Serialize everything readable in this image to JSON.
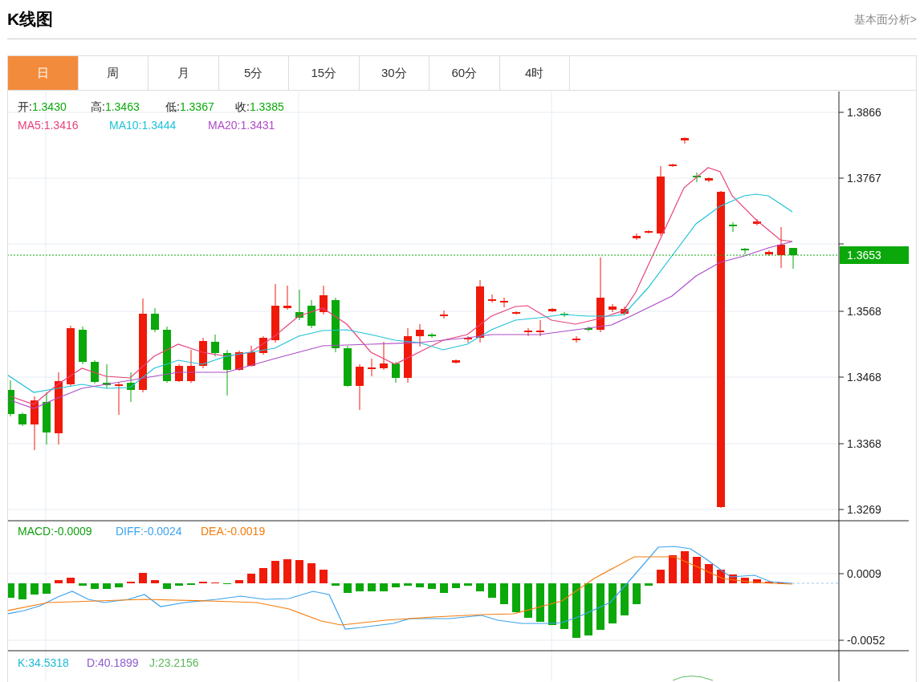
{
  "header": {
    "title": "K线图",
    "link": "基本面分析>"
  },
  "tabs": [
    {
      "label": "日",
      "selected": true
    },
    {
      "label": "周",
      "selected": false
    },
    {
      "label": "月",
      "selected": false
    },
    {
      "label": "5分",
      "selected": false
    },
    {
      "label": "15分",
      "selected": false
    },
    {
      "label": "30分",
      "selected": false
    },
    {
      "label": "60分",
      "selected": false
    },
    {
      "label": "4时",
      "selected": false
    }
  ],
  "price_legend": [
    {
      "label": "开:",
      "value": "1.3430"
    },
    {
      "label": "高:",
      "value": "1.3463"
    },
    {
      "label": "低:",
      "value": "1.3367"
    },
    {
      "label": "收:",
      "value": "1.3385"
    }
  ],
  "ma_legend": [
    {
      "label": "MA5:",
      "value": "1.3416",
      "color": "#e8417c"
    },
    {
      "label": "MA10:",
      "value": "1.3444",
      "color": "#1fc2d6"
    },
    {
      "label": "MA20:",
      "value": "1.3431",
      "color": "#ad4cc6"
    }
  ],
  "price_axis": {
    "ticks": [
      "1.3866",
      "1.3767",
      "1.3568",
      "1.3468",
      "1.3368",
      "1.3269"
    ],
    "last_price": "1.3653"
  },
  "macd_legend": [
    {
      "label": "MACD:",
      "value": "-0.0009",
      "color": "#12a012"
    },
    {
      "label": "DIFF:",
      "value": "-0.0024",
      "color": "#3ba3f0"
    },
    {
      "label": "DEA:",
      "value": "-0.0019",
      "color": "#f57c0c"
    }
  ],
  "macd_axis": {
    "ticks": [
      "0.0009",
      "-0.0052"
    ]
  },
  "kdj_legend": [
    {
      "label": "K:",
      "value": "34.5318",
      "color": "#1fbad6"
    },
    {
      "label": "D:",
      "value": "40.1899",
      "color": "#8c5ccf"
    },
    {
      "label": "J:",
      "value": "23.2156",
      "color": "#5cb85c"
    }
  ]
}
